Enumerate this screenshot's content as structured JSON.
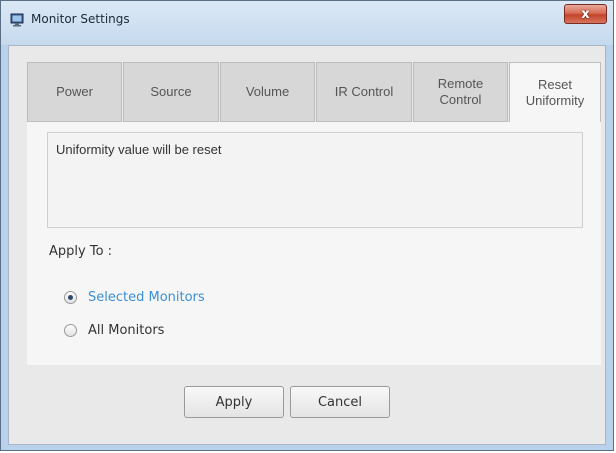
{
  "window": {
    "title": "Monitor Settings",
    "close_label": "x"
  },
  "tabs": [
    {
      "label": "Power"
    },
    {
      "label": "Source"
    },
    {
      "label": "Volume"
    },
    {
      "label": "IR Control"
    },
    {
      "label": "Remote\nControl"
    },
    {
      "label": "Reset\nUniformity",
      "active": true
    }
  ],
  "panel": {
    "message": "Uniformity value will be reset",
    "apply_to_label": "Apply To :",
    "options": [
      {
        "label": "Selected Monitors",
        "checked": true
      },
      {
        "label": "All Monitors",
        "checked": false
      }
    ]
  },
  "buttons": {
    "apply": "Apply",
    "cancel": "Cancel"
  },
  "colors": {
    "selected_option_text": "#3a8fd6",
    "close_button": "#c4432a",
    "window_frame": "#b9d1ea"
  }
}
